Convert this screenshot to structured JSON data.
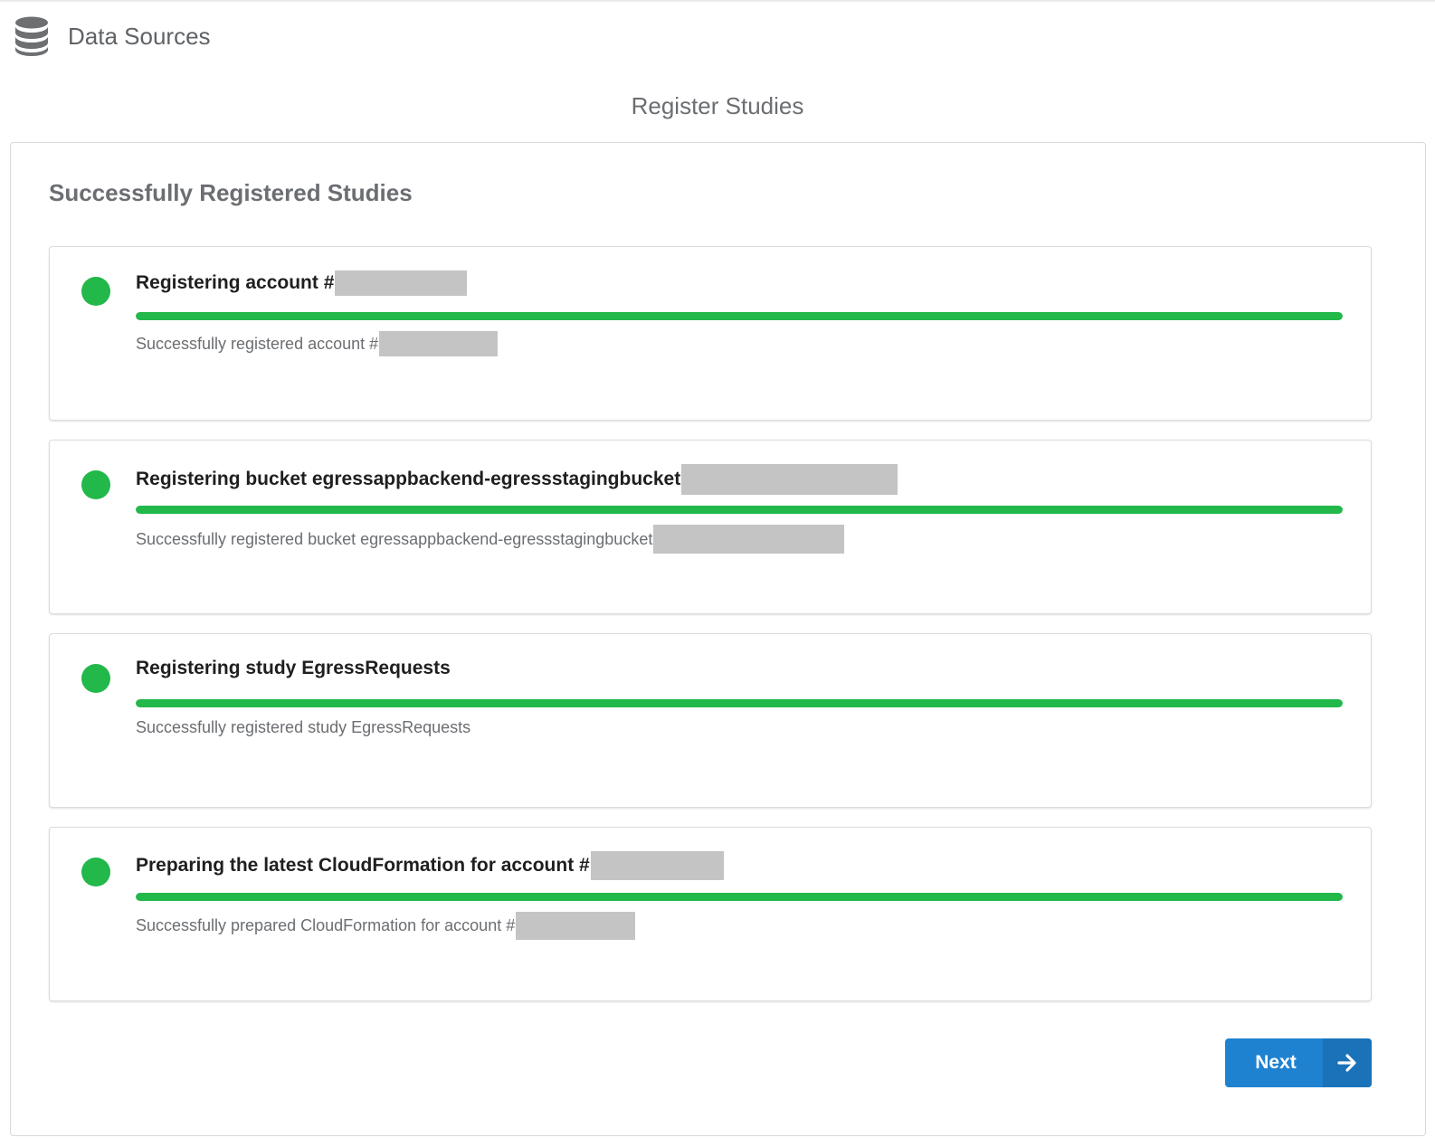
{
  "header": {
    "icon": "database-icon",
    "title": "Data Sources"
  },
  "page": {
    "title": "Register Studies"
  },
  "panel": {
    "title": "Successfully Registered Studies"
  },
  "colors": {
    "success": "#22b84a",
    "primary_button": "#1f82d0",
    "redaction": "#c4c4c4"
  },
  "steps": [
    {
      "title": "Registering account #",
      "status": "Successfully registered account #",
      "state": "success",
      "progress": 1.0
    },
    {
      "title": "Registering bucket egressappbackend-egressstagingbucket",
      "status": "Successfully registered bucket egressappbackend-egressstagingbucket",
      "state": "success",
      "progress": 1.0
    },
    {
      "title": "Registering study EgressRequests",
      "status": "Successfully registered study EgressRequests",
      "state": "success",
      "progress": 1.0
    },
    {
      "title": "Preparing the latest CloudFormation for account #",
      "status": "Successfully prepared CloudFormation for account #",
      "state": "success",
      "progress": 1.0
    }
  ],
  "actions": {
    "next_label": "Next",
    "next_icon": "arrow-right-icon"
  }
}
